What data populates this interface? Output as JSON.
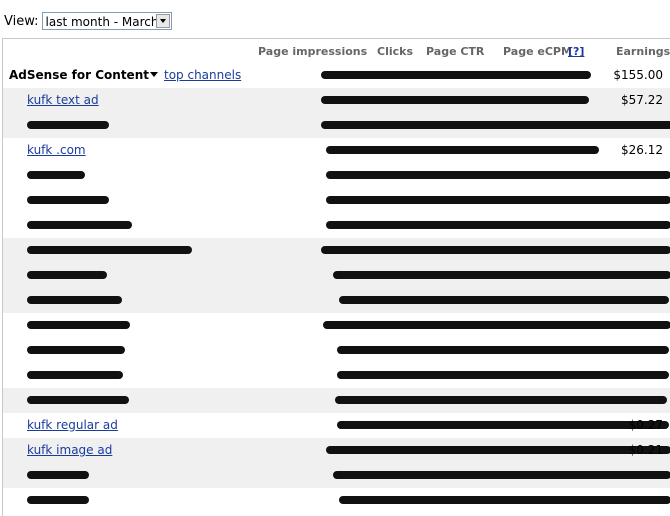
{
  "view": {
    "label": "View:",
    "selected": "last month - March"
  },
  "columns": {
    "impressions": "Page impressions",
    "clicks": "Clicks",
    "ctr": "Page CTR",
    "ecpm": "Page eCPM",
    "help": "[?]",
    "earnings": "Earnings"
  },
  "summary": {
    "title": "AdSense for Content",
    "channels_link": "top channels",
    "earnings": "$155.00"
  },
  "rows": [
    {
      "name": "kufk text ad",
      "earnings": "$57.22"
    },
    {
      "name": "",
      "earnings": ""
    },
    {
      "name": "kufk .com",
      "earnings": "$26.12"
    },
    {
      "name": "",
      "earnings": ""
    },
    {
      "name": "",
      "earnings": ""
    },
    {
      "name": "",
      "earnings": ""
    },
    {
      "name": "",
      "earnings": ""
    },
    {
      "name": "",
      "earnings": ""
    },
    {
      "name": "",
      "earnings": ""
    },
    {
      "name": "",
      "earnings": ""
    },
    {
      "name": "",
      "earnings": ""
    },
    {
      "name": "",
      "earnings": ""
    },
    {
      "name": "",
      "earnings": ""
    },
    {
      "name": "kufk regular ad",
      "earnings": "$0.27"
    },
    {
      "name": "kufk image ad",
      "earnings": "$0.21"
    },
    {
      "name": "",
      "earnings": ""
    },
    {
      "name": "",
      "earnings": ""
    }
  ]
}
